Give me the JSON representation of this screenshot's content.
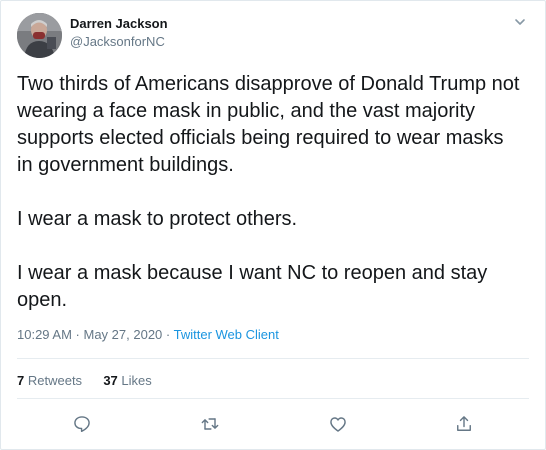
{
  "author": {
    "name": "Darren Jackson",
    "handle": "@JacksonforNC"
  },
  "tweet": {
    "paragraphs": [
      "Two thirds of Americans disapprove of Donald Trump not wearing a face mask in public, and the vast majority supports elected officials being required to wear masks in government buildings.",
      "I wear a mask to protect others.",
      "I wear a mask because I want NC to reopen and stay open."
    ]
  },
  "meta": {
    "time": "10:29 AM",
    "separator": " · ",
    "date": "May 27, 2020",
    "client": "Twitter Web Client"
  },
  "stats": {
    "retweets_count": "7",
    "retweets_label": "Retweets",
    "likes_count": "37",
    "likes_label": "Likes"
  },
  "actions": {
    "icons": [
      "reply-icon",
      "retweet-icon",
      "like-icon",
      "share-icon"
    ]
  },
  "colors": {
    "text": "#14171a",
    "secondary": "#657786",
    "link": "#1b95e0",
    "border": "#e6ecf0"
  }
}
